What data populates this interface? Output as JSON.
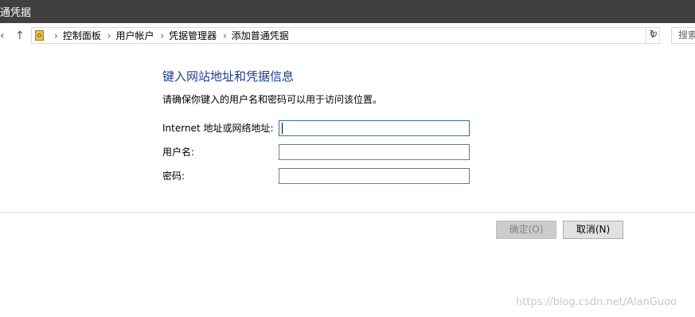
{
  "window": {
    "title": "通凭据"
  },
  "nav": {
    "back_icon": "chevron-left-icon",
    "up_icon": "arrow-up-icon",
    "breadcrumbs": [
      "控制面板",
      "用户帐户",
      "凭据管理器",
      "添加普通凭据"
    ],
    "search_placeholder": "搜索"
  },
  "main": {
    "heading": "键入网站地址和凭据信息",
    "description": "请确保你键入的用户名和密码可以用于访问该位置。",
    "fields": [
      {
        "label": "Internet 地址或网络地址:",
        "value": ""
      },
      {
        "label": "用户名:",
        "value": ""
      },
      {
        "label": "密码:",
        "value": ""
      }
    ]
  },
  "buttons": {
    "ok": "确定(O)",
    "cancel": "取消(N)"
  },
  "watermark": "https://blog.csdn.net/AlanGuoo",
  "colors": {
    "titlebar": "#404040",
    "heading": "#1e3e8c",
    "focus_border": "#2d6fa8"
  }
}
